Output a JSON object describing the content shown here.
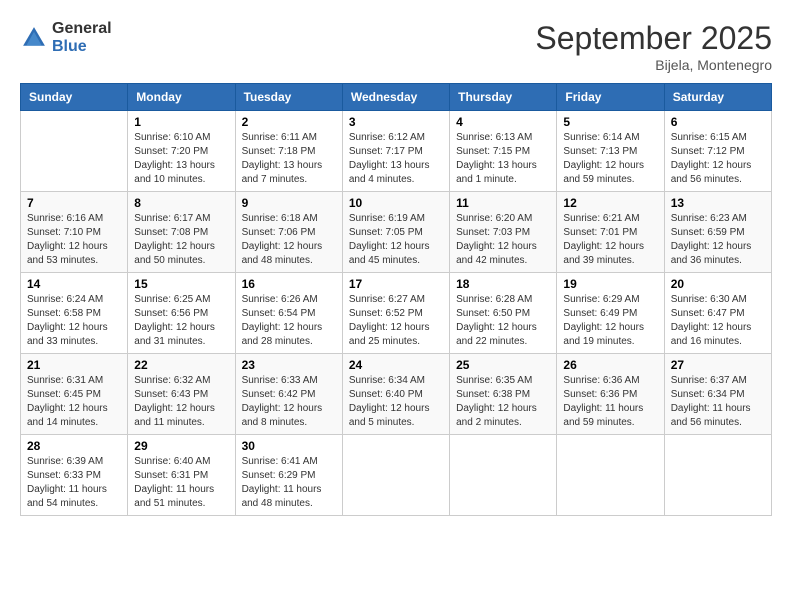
{
  "header": {
    "logo_general": "General",
    "logo_blue": "Blue",
    "month_title": "September 2025",
    "subtitle": "Bijela, Montenegro"
  },
  "days": [
    "Sunday",
    "Monday",
    "Tuesday",
    "Wednesday",
    "Thursday",
    "Friday",
    "Saturday"
  ],
  "weeks": [
    [
      {
        "date": "",
        "sunrise": "",
        "sunset": "",
        "daylight": ""
      },
      {
        "date": "1",
        "sunrise": "Sunrise: 6:10 AM",
        "sunset": "Sunset: 7:20 PM",
        "daylight": "Daylight: 13 hours and 10 minutes."
      },
      {
        "date": "2",
        "sunrise": "Sunrise: 6:11 AM",
        "sunset": "Sunset: 7:18 PM",
        "daylight": "Daylight: 13 hours and 7 minutes."
      },
      {
        "date": "3",
        "sunrise": "Sunrise: 6:12 AM",
        "sunset": "Sunset: 7:17 PM",
        "daylight": "Daylight: 13 hours and 4 minutes."
      },
      {
        "date": "4",
        "sunrise": "Sunrise: 6:13 AM",
        "sunset": "Sunset: 7:15 PM",
        "daylight": "Daylight: 13 hours and 1 minute."
      },
      {
        "date": "5",
        "sunrise": "Sunrise: 6:14 AM",
        "sunset": "Sunset: 7:13 PM",
        "daylight": "Daylight: 12 hours and 59 minutes."
      },
      {
        "date": "6",
        "sunrise": "Sunrise: 6:15 AM",
        "sunset": "Sunset: 7:12 PM",
        "daylight": "Daylight: 12 hours and 56 minutes."
      }
    ],
    [
      {
        "date": "7",
        "sunrise": "Sunrise: 6:16 AM",
        "sunset": "Sunset: 7:10 PM",
        "daylight": "Daylight: 12 hours and 53 minutes."
      },
      {
        "date": "8",
        "sunrise": "Sunrise: 6:17 AM",
        "sunset": "Sunset: 7:08 PM",
        "daylight": "Daylight: 12 hours and 50 minutes."
      },
      {
        "date": "9",
        "sunrise": "Sunrise: 6:18 AM",
        "sunset": "Sunset: 7:06 PM",
        "daylight": "Daylight: 12 hours and 48 minutes."
      },
      {
        "date": "10",
        "sunrise": "Sunrise: 6:19 AM",
        "sunset": "Sunset: 7:05 PM",
        "daylight": "Daylight: 12 hours and 45 minutes."
      },
      {
        "date": "11",
        "sunrise": "Sunrise: 6:20 AM",
        "sunset": "Sunset: 7:03 PM",
        "daylight": "Daylight: 12 hours and 42 minutes."
      },
      {
        "date": "12",
        "sunrise": "Sunrise: 6:21 AM",
        "sunset": "Sunset: 7:01 PM",
        "daylight": "Daylight: 12 hours and 39 minutes."
      },
      {
        "date": "13",
        "sunrise": "Sunrise: 6:23 AM",
        "sunset": "Sunset: 6:59 PM",
        "daylight": "Daylight: 12 hours and 36 minutes."
      }
    ],
    [
      {
        "date": "14",
        "sunrise": "Sunrise: 6:24 AM",
        "sunset": "Sunset: 6:58 PM",
        "daylight": "Daylight: 12 hours and 33 minutes."
      },
      {
        "date": "15",
        "sunrise": "Sunrise: 6:25 AM",
        "sunset": "Sunset: 6:56 PM",
        "daylight": "Daylight: 12 hours and 31 minutes."
      },
      {
        "date": "16",
        "sunrise": "Sunrise: 6:26 AM",
        "sunset": "Sunset: 6:54 PM",
        "daylight": "Daylight: 12 hours and 28 minutes."
      },
      {
        "date": "17",
        "sunrise": "Sunrise: 6:27 AM",
        "sunset": "Sunset: 6:52 PM",
        "daylight": "Daylight: 12 hours and 25 minutes."
      },
      {
        "date": "18",
        "sunrise": "Sunrise: 6:28 AM",
        "sunset": "Sunset: 6:50 PM",
        "daylight": "Daylight: 12 hours and 22 minutes."
      },
      {
        "date": "19",
        "sunrise": "Sunrise: 6:29 AM",
        "sunset": "Sunset: 6:49 PM",
        "daylight": "Daylight: 12 hours and 19 minutes."
      },
      {
        "date": "20",
        "sunrise": "Sunrise: 6:30 AM",
        "sunset": "Sunset: 6:47 PM",
        "daylight": "Daylight: 12 hours and 16 minutes."
      }
    ],
    [
      {
        "date": "21",
        "sunrise": "Sunrise: 6:31 AM",
        "sunset": "Sunset: 6:45 PM",
        "daylight": "Daylight: 12 hours and 14 minutes."
      },
      {
        "date": "22",
        "sunrise": "Sunrise: 6:32 AM",
        "sunset": "Sunset: 6:43 PM",
        "daylight": "Daylight: 12 hours and 11 minutes."
      },
      {
        "date": "23",
        "sunrise": "Sunrise: 6:33 AM",
        "sunset": "Sunset: 6:42 PM",
        "daylight": "Daylight: 12 hours and 8 minutes."
      },
      {
        "date": "24",
        "sunrise": "Sunrise: 6:34 AM",
        "sunset": "Sunset: 6:40 PM",
        "daylight": "Daylight: 12 hours and 5 minutes."
      },
      {
        "date": "25",
        "sunrise": "Sunrise: 6:35 AM",
        "sunset": "Sunset: 6:38 PM",
        "daylight": "Daylight: 12 hours and 2 minutes."
      },
      {
        "date": "26",
        "sunrise": "Sunrise: 6:36 AM",
        "sunset": "Sunset: 6:36 PM",
        "daylight": "Daylight: 11 hours and 59 minutes."
      },
      {
        "date": "27",
        "sunrise": "Sunrise: 6:37 AM",
        "sunset": "Sunset: 6:34 PM",
        "daylight": "Daylight: 11 hours and 56 minutes."
      }
    ],
    [
      {
        "date": "28",
        "sunrise": "Sunrise: 6:39 AM",
        "sunset": "Sunset: 6:33 PM",
        "daylight": "Daylight: 11 hours and 54 minutes."
      },
      {
        "date": "29",
        "sunrise": "Sunrise: 6:40 AM",
        "sunset": "Sunset: 6:31 PM",
        "daylight": "Daylight: 11 hours and 51 minutes."
      },
      {
        "date": "30",
        "sunrise": "Sunrise: 6:41 AM",
        "sunset": "Sunset: 6:29 PM",
        "daylight": "Daylight: 11 hours and 48 minutes."
      },
      {
        "date": "",
        "sunrise": "",
        "sunset": "",
        "daylight": ""
      },
      {
        "date": "",
        "sunrise": "",
        "sunset": "",
        "daylight": ""
      },
      {
        "date": "",
        "sunrise": "",
        "sunset": "",
        "daylight": ""
      },
      {
        "date": "",
        "sunrise": "",
        "sunset": "",
        "daylight": ""
      }
    ]
  ]
}
